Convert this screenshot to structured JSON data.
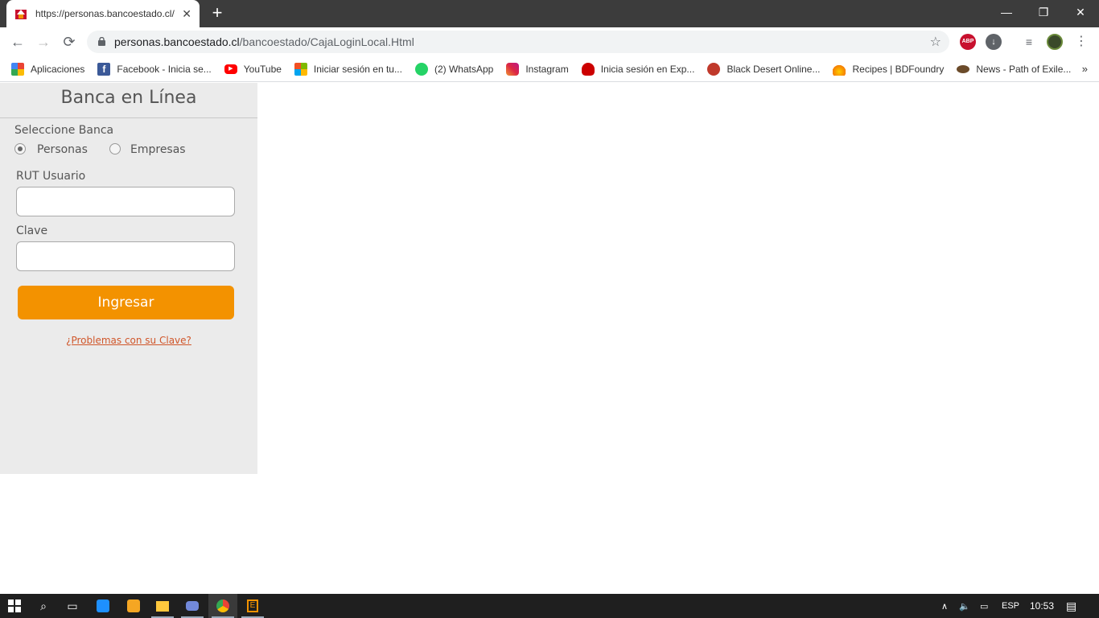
{
  "browser": {
    "tab_title": "https://personas.bancoestado.cl/",
    "tab_close": "✕",
    "new_tab": "+",
    "window_controls": {
      "minimize": "—",
      "restore": "❐",
      "close": "✕"
    },
    "url_host": "personas.bancoestado.cl",
    "url_path": "/bancoestado/CajaLoginLocal.Html",
    "ext_abp_label": "ABP",
    "bookmarks": [
      {
        "label": "Aplicaciones",
        "icon": "apps-grid-icon",
        "color": "#ea4335"
      },
      {
        "label": "Facebook - Inicia se...",
        "icon": "facebook-icon",
        "color": "#3b5998"
      },
      {
        "label": "YouTube",
        "icon": "youtube-icon",
        "color": "#ff0000"
      },
      {
        "label": "Iniciar sesión en tu...",
        "icon": "microsoft-icon",
        "color": "#f25022"
      },
      {
        "label": "(2) WhatsApp",
        "icon": "whatsapp-icon",
        "color": "#25d366"
      },
      {
        "label": "Instagram",
        "icon": "instagram-icon",
        "color": "#c13584"
      },
      {
        "label": "Inicia sesión en Exp...",
        "icon": "redhat-icon",
        "color": "#cc0000"
      },
      {
        "label": "Black Desert Online...",
        "icon": "bdo-icon",
        "color": "#c0392b"
      },
      {
        "label": "Recipes | BDFoundry",
        "icon": "flame-icon",
        "color": "#f57c00"
      },
      {
        "label": "News - Path of Exile...",
        "icon": "poe-icon",
        "color": "#6b4b2a"
      }
    ],
    "bookmarks_more": "»"
  },
  "login": {
    "title": "Banca en Línea",
    "select_bank_label": "Seleccione Banca",
    "option_personas": "Personas",
    "option_empresas": "Empresas",
    "selected": "Personas",
    "rut_label": "RUT Usuario",
    "rut_value": "",
    "clave_label": "Clave",
    "clave_value": "",
    "submit_label": "Ingresar",
    "problems_link": "¿Problemas con su Clave?",
    "accent_color": "#f39200"
  },
  "taskbar": {
    "language": "ESP",
    "time": "10:53"
  }
}
